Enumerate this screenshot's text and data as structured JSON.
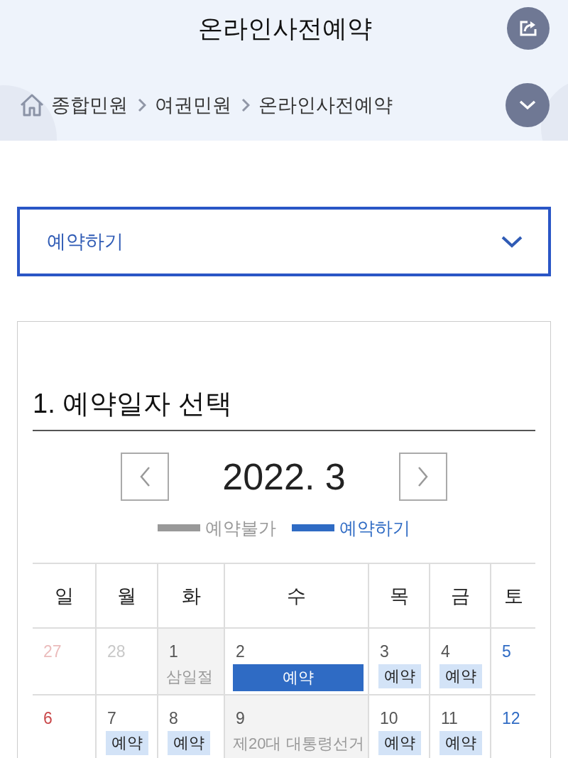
{
  "header": {
    "title": "온라인사전예약",
    "breadcrumb": [
      "종합민원",
      "여권민원",
      "온라인사전예약"
    ]
  },
  "select": {
    "value": "예약하기"
  },
  "section": {
    "title": "1. 예약일자 선택"
  },
  "calendar": {
    "month": "2022. 3",
    "legend": [
      {
        "label": "예약불가",
        "color": "#999999"
      },
      {
        "label": "예약하기",
        "color": "#2f6bc4"
      }
    ],
    "weekdays": [
      "일",
      "월",
      "화",
      "수",
      "목",
      "금",
      "토"
    ],
    "weeks": [
      [
        {
          "day": "27",
          "kind": "outside"
        },
        {
          "day": "28",
          "kind": "outside"
        },
        {
          "day": "1",
          "kind": "holiday",
          "note": "삼일절"
        },
        {
          "day": "2",
          "kind": "day",
          "reserve": {
            "label": "예약",
            "selected": true
          }
        },
        {
          "day": "3",
          "kind": "day",
          "reserve": {
            "label": "예약",
            "selected": false
          }
        },
        {
          "day": "4",
          "kind": "day",
          "reserve": {
            "label": "예약",
            "selected": false
          }
        },
        {
          "day": "5",
          "kind": "day"
        }
      ],
      [
        {
          "day": "6",
          "kind": "day"
        },
        {
          "day": "7",
          "kind": "day",
          "reserve": {
            "label": "예약",
            "selected": false
          }
        },
        {
          "day": "8",
          "kind": "day",
          "reserve": {
            "label": "예약",
            "selected": false
          }
        },
        {
          "day": "9",
          "kind": "holiday",
          "note": "제20대 대통령선거"
        },
        {
          "day": "10",
          "kind": "day",
          "reserve": {
            "label": "예약",
            "selected": false
          }
        },
        {
          "day": "11",
          "kind": "day",
          "reserve": {
            "label": "예약",
            "selected": false
          }
        },
        {
          "day": "12",
          "kind": "day"
        }
      ]
    ]
  }
}
